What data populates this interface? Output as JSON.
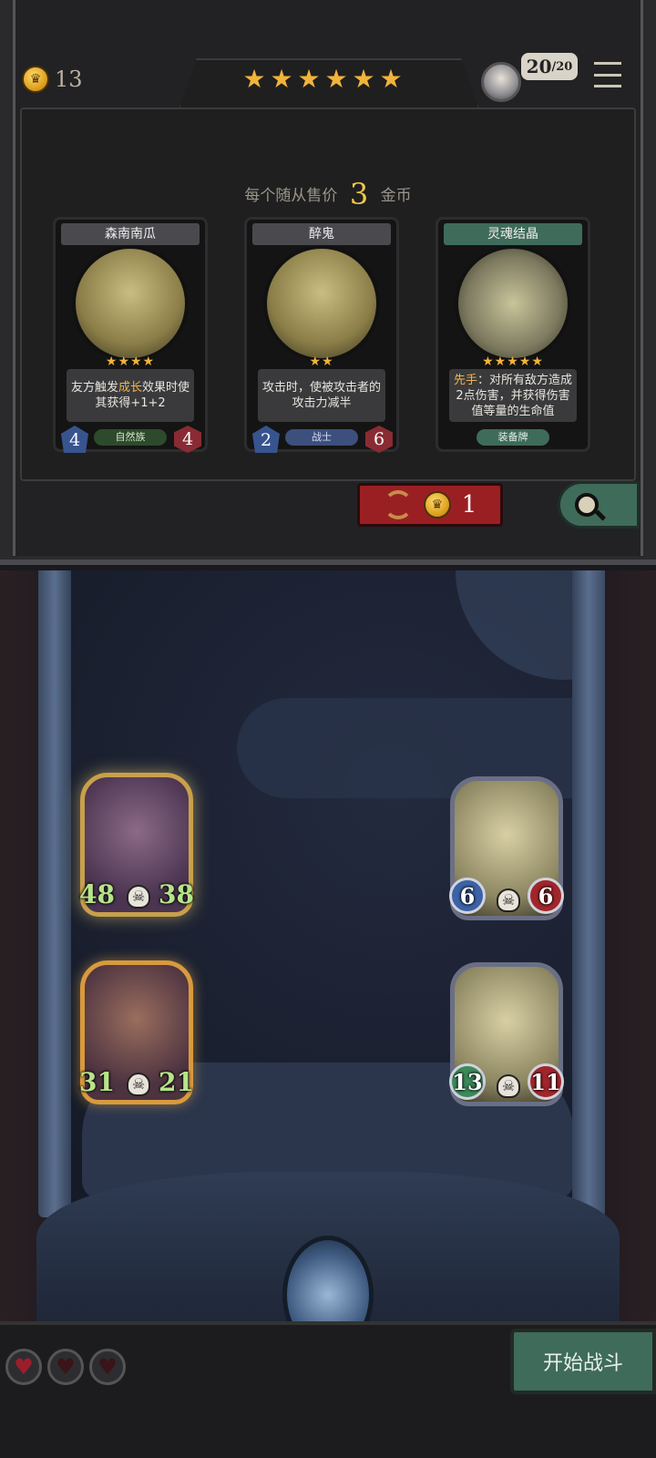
{
  "header": {
    "coins": "13",
    "tier_stars": 6,
    "population": "20",
    "population_max": "20"
  },
  "shop": {
    "price_prefix": "每个随从售价",
    "price_value": "3",
    "price_suffix": "金币",
    "refresh_cost": "1",
    "cards": [
      {
        "name": "森南南瓜",
        "stars": 4,
        "desc_pre": "友方触发",
        "desc_hl": "成长",
        "desc_post": "效果时使其获得+1+2",
        "tag": "自然族",
        "attack": "4",
        "health": "4"
      },
      {
        "name": "醉鬼",
        "stars": 2,
        "desc_pre": "攻击时，使被攻击者的攻击力减半",
        "desc_hl": "",
        "desc_post": "",
        "tag": "战士",
        "attack": "2",
        "health": "6"
      },
      {
        "name": "灵魂结晶",
        "stars": 5,
        "desc_pre": "",
        "desc_hl": "先手",
        "desc_post": "：对所有敌方造成2点伤害，并获得伤害值等量的生命值",
        "tag": "装备牌",
        "attack": "",
        "health": ""
      }
    ]
  },
  "board": {
    "player_minions": [
      {
        "attack": "48",
        "health": "38"
      },
      {
        "attack": "31",
        "health": "21"
      }
    ],
    "enemy_minions": [
      {
        "attack": "6",
        "health": "6"
      },
      {
        "attack": "13",
        "health": "11"
      }
    ]
  },
  "footer": {
    "lives_total": 3,
    "start_label": "开始战斗"
  },
  "colors": {
    "gold": "#f1b33a",
    "refresh_red": "#9a1f22",
    "action_green": "#3f6b5a"
  }
}
